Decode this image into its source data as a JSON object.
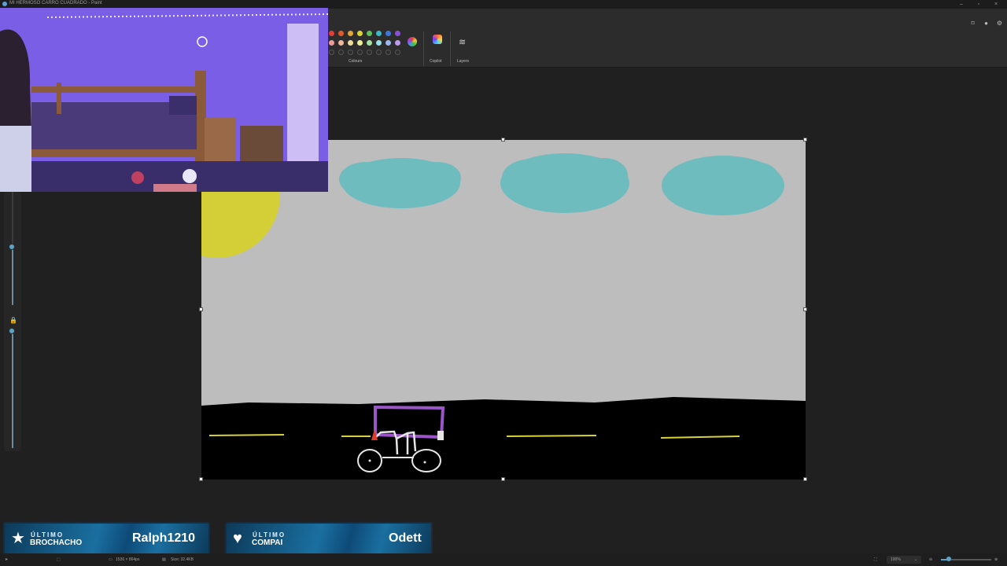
{
  "window": {
    "title": "MI HERMOSO CARRO CUADRADO - Paint"
  },
  "toolbar": {
    "colours_label": "Colours",
    "copilot_label": "Copilot",
    "layers_label": "Layers",
    "swatches_row1": [
      "#e23b3b",
      "#e05a2a",
      "#e0a53b",
      "#d9d13a",
      "#5fbf5a",
      "#3bb7c7",
      "#3b77d9",
      "#8a4fd9"
    ],
    "swatches_row2": [
      "#f09a9a",
      "#f0b89a",
      "#f0dc9a",
      "#ecec9a",
      "#a8e0a0",
      "#9ae0ea",
      "#9ab8f0",
      "#c09af0"
    ]
  },
  "drawing": {
    "sky_color": "#bdbdbd",
    "road_color": "#000000",
    "cloud_color": "#6fbcbe",
    "sun_color": "#d5cf37",
    "lane_color": "#d8d23a",
    "car_body_color": "#9b55c8",
    "car_frame_color": "#e6e6e6",
    "car_light_color": "#e03a2a"
  },
  "banners": [
    {
      "small": "ÚLTIMO",
      "role": "BROCHACHO",
      "name": "Ralph1210",
      "icon": "star-icon"
    },
    {
      "small": "ÚLTIMO",
      "role": "COMPAI",
      "name": "Odett",
      "icon": "heart-icon"
    }
  ],
  "status": {
    "dimensions": "1536 × 864px",
    "size": "Size: 32.4KB",
    "zoom": "100%"
  }
}
